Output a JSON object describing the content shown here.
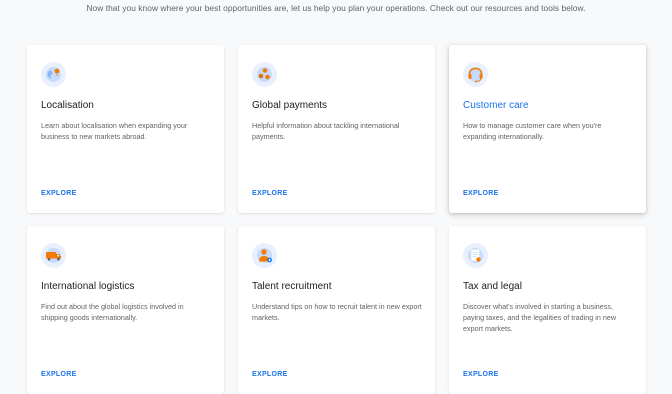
{
  "intro": "Now that you know where your best opportunities are, let us help you plan your operations. Check out our resources and tools below.",
  "cards": [
    {
      "icon": "globe-icon",
      "title": "Localisation",
      "description": "Learn about localisation when expanding your business to new markets abroad.",
      "link": "EXPLORE"
    },
    {
      "icon": "payments-icon",
      "title": "Global payments",
      "description": "Helpful information about tackling international payments.",
      "link": "EXPLORE"
    },
    {
      "icon": "headset-icon",
      "title": "Customer care",
      "description": "How to manage customer care when you're expanding internationally.",
      "link": "EXPLORE"
    },
    {
      "icon": "truck-icon",
      "title": "International logistics",
      "description": "Find out about the global logistics involved in shipping goods internationally.",
      "link": "EXPLORE"
    },
    {
      "icon": "recruit-icon",
      "title": "Talent recruitment",
      "description": "Understand tips on how to recruit talent in new export markets.",
      "link": "EXPLORE"
    },
    {
      "icon": "document-icon",
      "title": "Tax and legal",
      "description": "Discover what's involved in starting a business, paying taxes, and the legalities of trading in new export markets.",
      "link": "EXPLORE"
    }
  ],
  "colors": {
    "accent": "#1a73e8",
    "icon_bg": "#e8f0fe",
    "orange": "#f57c00"
  }
}
